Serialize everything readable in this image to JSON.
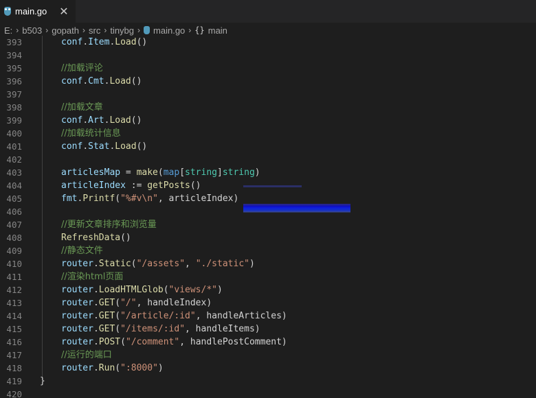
{
  "tab": {
    "filename": "main.go",
    "close_glyph": "✕"
  },
  "breadcrumb": {
    "parts": [
      "E:",
      "b503",
      "gopath",
      "src",
      "tinybg"
    ],
    "file": "main.go",
    "symbol": "main",
    "symbol_glyph": "{}"
  },
  "colors": {
    "background": "#1e1e1e",
    "variable": "#9cdcfe",
    "function": "#dcdcaa",
    "type": "#4ec9b0",
    "keyword": "#569cd6",
    "string": "#ce9178",
    "comment": "#6a9955",
    "line_number": "#858585"
  },
  "lines": [
    {
      "n": "393",
      "tokens": [
        [
          "v",
          "conf"
        ],
        [
          "p",
          "."
        ],
        [
          "v",
          "Item"
        ],
        [
          "p",
          "."
        ],
        [
          "f",
          "Load"
        ],
        [
          "p",
          "()"
        ]
      ]
    },
    {
      "n": "394",
      "tokens": []
    },
    {
      "n": "395",
      "tokens": [
        [
          "c",
          "//加载评论"
        ]
      ]
    },
    {
      "n": "396",
      "tokens": [
        [
          "v",
          "conf"
        ],
        [
          "p",
          "."
        ],
        [
          "v",
          "Cmt"
        ],
        [
          "p",
          "."
        ],
        [
          "f",
          "Load"
        ],
        [
          "p",
          "()"
        ]
      ]
    },
    {
      "n": "397",
      "tokens": []
    },
    {
      "n": "398",
      "tokens": [
        [
          "c",
          "//加载文章"
        ]
      ]
    },
    {
      "n": "399",
      "tokens": [
        [
          "v",
          "conf"
        ],
        [
          "p",
          "."
        ],
        [
          "v",
          "Art"
        ],
        [
          "p",
          "."
        ],
        [
          "f",
          "Load"
        ],
        [
          "p",
          "()"
        ]
      ]
    },
    {
      "n": "400",
      "tokens": [
        [
          "c",
          "//加载统计信息"
        ]
      ]
    },
    {
      "n": "401",
      "tokens": [
        [
          "v",
          "conf"
        ],
        [
          "p",
          "."
        ],
        [
          "v",
          "Stat"
        ],
        [
          "p",
          "."
        ],
        [
          "f",
          "Load"
        ],
        [
          "p",
          "()"
        ]
      ]
    },
    {
      "n": "402",
      "tokens": []
    },
    {
      "n": "403",
      "tokens": [
        [
          "v",
          "articlesMap"
        ],
        [
          "p",
          " = "
        ],
        [
          "f",
          "make"
        ],
        [
          "p",
          "("
        ],
        [
          "k",
          "map"
        ],
        [
          "p",
          "["
        ],
        [
          "t",
          "string"
        ],
        [
          "p",
          "]"
        ],
        [
          "t",
          "string"
        ],
        [
          "p",
          ")"
        ]
      ]
    },
    {
      "n": "404",
      "tokens": [
        [
          "v",
          "articleIndex"
        ],
        [
          "p",
          " := "
        ],
        [
          "f",
          "getPosts"
        ],
        [
          "p",
          "()"
        ]
      ]
    },
    {
      "n": "405",
      "tokens": [
        [
          "v",
          "fmt"
        ],
        [
          "p",
          "."
        ],
        [
          "f",
          "Printf"
        ],
        [
          "p",
          "("
        ],
        [
          "s",
          "\"%#v\\n\""
        ],
        [
          "p",
          ", articleIndex)"
        ]
      ]
    },
    {
      "n": "406",
      "tokens": []
    },
    {
      "n": "407",
      "tokens": [
        [
          "c",
          "//更新文章排序和浏览量"
        ]
      ]
    },
    {
      "n": "408",
      "tokens": [
        [
          "f",
          "RefreshData"
        ],
        [
          "p",
          "()"
        ]
      ]
    },
    {
      "n": "409",
      "tokens": [
        [
          "c",
          "//静态文件"
        ]
      ]
    },
    {
      "n": "410",
      "tokens": [
        [
          "v",
          "router"
        ],
        [
          "p",
          "."
        ],
        [
          "f",
          "Static"
        ],
        [
          "p",
          "("
        ],
        [
          "s",
          "\"/assets\""
        ],
        [
          "p",
          ", "
        ],
        [
          "s",
          "\"./static\""
        ],
        [
          "p",
          ")"
        ]
      ]
    },
    {
      "n": "411",
      "tokens": [
        [
          "c",
          "//渲染html页面"
        ]
      ]
    },
    {
      "n": "412",
      "tokens": [
        [
          "v",
          "router"
        ],
        [
          "p",
          "."
        ],
        [
          "f",
          "LoadHTMLGlob"
        ],
        [
          "p",
          "("
        ],
        [
          "s",
          "\"views/*\""
        ],
        [
          "p",
          ")"
        ]
      ]
    },
    {
      "n": "413",
      "tokens": [
        [
          "v",
          "router"
        ],
        [
          "p",
          "."
        ],
        [
          "f",
          "GET"
        ],
        [
          "p",
          "("
        ],
        [
          "s",
          "\"/\""
        ],
        [
          "p",
          ", handleIndex)"
        ]
      ]
    },
    {
      "n": "414",
      "tokens": [
        [
          "v",
          "router"
        ],
        [
          "p",
          "."
        ],
        [
          "f",
          "GET"
        ],
        [
          "p",
          "("
        ],
        [
          "s",
          "\"/article/:id\""
        ],
        [
          "p",
          ", handleArticles)"
        ]
      ]
    },
    {
      "n": "415",
      "tokens": [
        [
          "v",
          "router"
        ],
        [
          "p",
          "."
        ],
        [
          "f",
          "GET"
        ],
        [
          "p",
          "("
        ],
        [
          "s",
          "\"/items/:id\""
        ],
        [
          "p",
          ", handleItems)"
        ]
      ]
    },
    {
      "n": "416",
      "tokens": [
        [
          "v",
          "router"
        ],
        [
          "p",
          "."
        ],
        [
          "f",
          "POST"
        ],
        [
          "p",
          "("
        ],
        [
          "s",
          "\"/comment\""
        ],
        [
          "p",
          ", handlePostComment)"
        ]
      ]
    },
    {
      "n": "417",
      "tokens": [
        [
          "c",
          "//运行的端口"
        ]
      ]
    },
    {
      "n": "418",
      "tokens": [
        [
          "v",
          "router"
        ],
        [
          "p",
          "."
        ],
        [
          "f",
          "Run"
        ],
        [
          "p",
          "("
        ],
        [
          "s",
          "\":8000\""
        ],
        [
          "p",
          ")"
        ]
      ]
    },
    {
      "n": "419",
      "tokens": [
        [
          "p",
          "}"
        ]
      ],
      "outdent": true
    },
    {
      "n": "420",
      "tokens": []
    }
  ]
}
